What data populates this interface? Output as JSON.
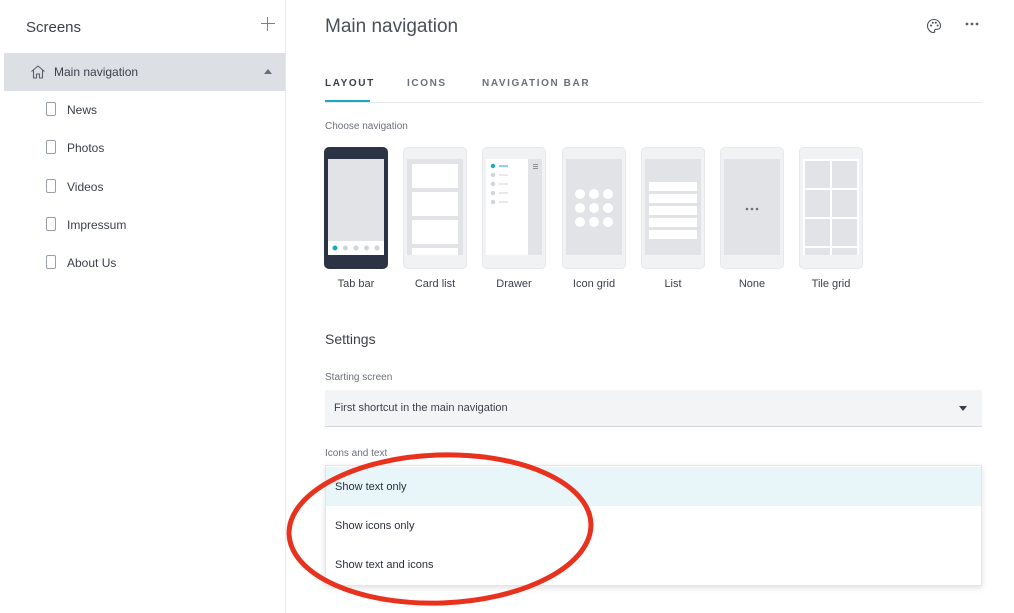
{
  "sidebar": {
    "title": "Screens",
    "main_item": {
      "label": "Main navigation"
    },
    "items": [
      {
        "label": "News"
      },
      {
        "label": "Photos"
      },
      {
        "label": "Videos"
      },
      {
        "label": "Impressum"
      },
      {
        "label": "About Us"
      }
    ]
  },
  "main": {
    "title": "Main navigation",
    "tabs": [
      {
        "label": "LAYOUT",
        "active": true
      },
      {
        "label": "ICONS",
        "active": false
      },
      {
        "label": "NAVIGATION BAR",
        "active": false
      }
    ],
    "choose_navigation_label": "Choose navigation",
    "nav_options": [
      {
        "label": "Tab bar",
        "selected": true
      },
      {
        "label": "Card list",
        "selected": false
      },
      {
        "label": "Drawer",
        "selected": false
      },
      {
        "label": "Icon grid",
        "selected": false
      },
      {
        "label": "List",
        "selected": false
      },
      {
        "label": "None",
        "selected": false
      },
      {
        "label": "Tile grid",
        "selected": false
      }
    ],
    "settings_title": "Settings",
    "starting_screen": {
      "label": "Starting screen",
      "value": "First shortcut in the main navigation"
    },
    "icons_and_text": {
      "label": "Icons and text",
      "options": [
        {
          "label": "Show text only",
          "highlighted": true
        },
        {
          "label": "Show icons only",
          "highlighted": false
        },
        {
          "label": "Show text and icons",
          "highlighted": false
        }
      ]
    }
  },
  "colors": {
    "accent": "#1ea7c5",
    "selected_thumb": "#2c3345",
    "sidebar_active": "#dcdfe4",
    "annotation": "#e8321e",
    "dropdown_highlight": "#e8f6fa"
  },
  "icons": {
    "add": "plus-icon",
    "home": "home-icon",
    "page": "page-icon",
    "palette": "palette-icon",
    "more": "more-icon",
    "caret_up": "chevron-up-icon",
    "dropdown": "chevron-down-icon"
  }
}
